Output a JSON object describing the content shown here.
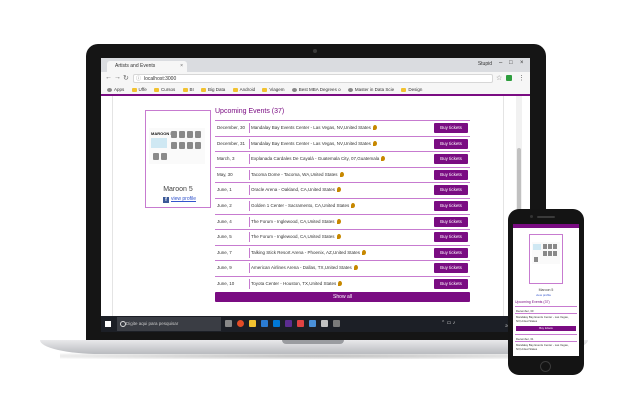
{
  "browser": {
    "tab_title": "Artists and Events",
    "tab_close": "×",
    "user_name": "Stupid",
    "url": "localhost:3000",
    "bookmarks": [
      "Apps",
      "Uffe",
      "Cursos",
      "BI",
      "Big Data",
      "Android",
      "Viagem",
      "Best MBA Degrees o",
      "Master in Data Scie",
      "Design"
    ]
  },
  "artist": {
    "poster_title": "MAROON 5",
    "name": "Maroon 5",
    "fb_icon": "f",
    "view_profile": "view profile"
  },
  "events": {
    "heading": "Upcoming Events (37)",
    "buy_label": "Buy tickets",
    "rows": [
      {
        "date": "December, 30",
        "venue": "Mandalay Bay Events Center - Las Vegas, NV,United States"
      },
      {
        "date": "December, 31",
        "venue": "Mandalay Bay Events Center - Las Vegas, NV,United States"
      },
      {
        "date": "March, 3",
        "venue": "Explanada Cardales De Cayalá - Guatemala City, 07,Guatemala"
      },
      {
        "date": "May, 30",
        "venue": "Tacoma Dome - Tacoma, WA,United States"
      },
      {
        "date": "June, 1",
        "venue": "Oracle Arena - Oakland, CA,United States"
      },
      {
        "date": "June, 2",
        "venue": "Golden 1 Center - Sacramento, CA,United States"
      },
      {
        "date": "June, 4",
        "venue": "The Forum - Inglewood, CA,United States"
      },
      {
        "date": "June, 5",
        "venue": "The Forum - Inglewood, CA,United States"
      },
      {
        "date": "June, 7",
        "venue": "Talking Stick Resort Arena - Phoenix, AZ,United States"
      },
      {
        "date": "June, 9",
        "venue": "American Airlines Arena - Dallas, TX,United States"
      },
      {
        "date": "June, 10",
        "venue": "Toyota Center - Houston, TX,United States"
      }
    ],
    "show_all": "Show all"
  },
  "taskbar": {
    "search_placeholder": "Digite aqui para pesquisar",
    "lang": "POR\nPTB2",
    "time": "21:18",
    "date": "26/11/2017"
  },
  "phone": {
    "artist_name": "Maroon 5",
    "view_profile": "view profile",
    "heading": "Upcoming Events (37)",
    "row1_date": "December, 30",
    "row1_venue": "Mandalay Bay Events Center - Las Vegas, NV,United States",
    "buy_label": "Buy tickets",
    "row2_date": "December, 31",
    "row2_venue": "Mandalay Bay Events Center - Las Vegas, NV,United States"
  },
  "colors": {
    "accent": "#7a0c82",
    "border": "#c77bd0",
    "taskbar": "#1c1f26"
  }
}
